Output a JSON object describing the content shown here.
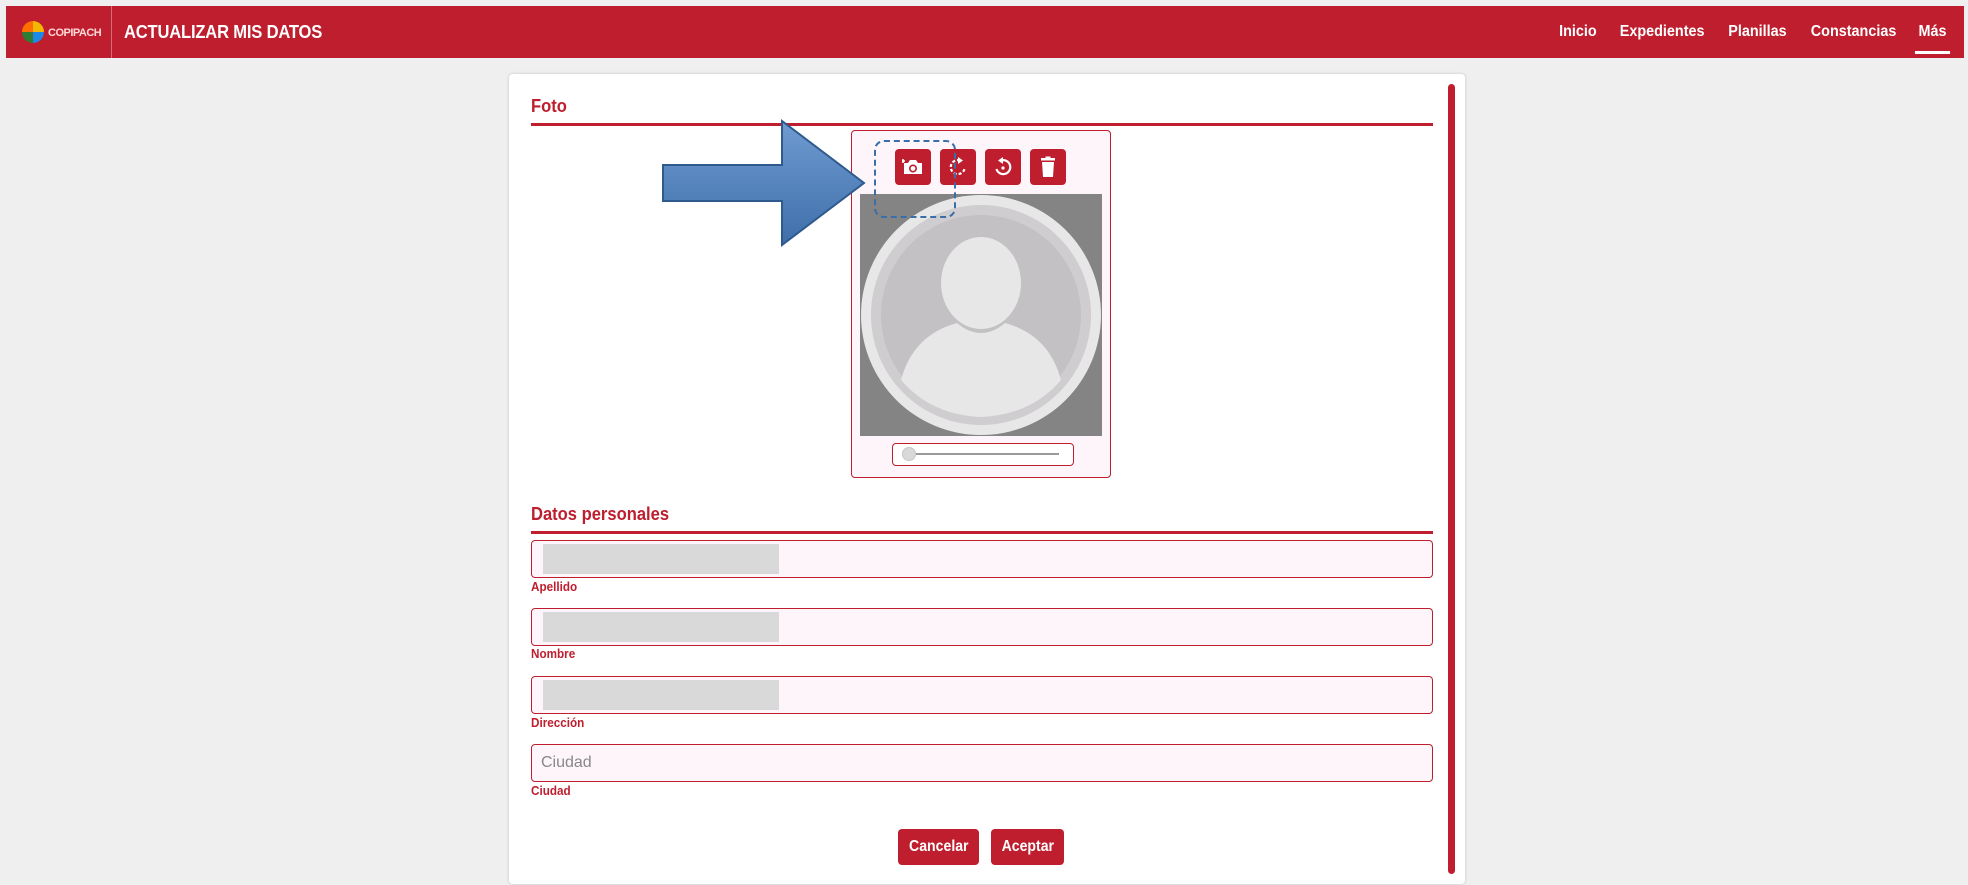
{
  "header": {
    "logo_text": "COPIPACH",
    "title": "ACTUALIZAR MIS DATOS",
    "nav": [
      {
        "label": "Inicio"
      },
      {
        "label": "Expedientes"
      },
      {
        "label": "Planillas"
      },
      {
        "label": "Constancias"
      },
      {
        "label": "Más",
        "active": true
      }
    ]
  },
  "photo_section": {
    "title": "Foto",
    "tools": [
      "camera-icon",
      "rotate-right-icon",
      "rotate-left-icon",
      "trash-icon"
    ],
    "zoom_level": 0
  },
  "personal_section": {
    "title": "Datos personales",
    "fields": [
      {
        "label": "Apellido",
        "value": "",
        "placeholder": ""
      },
      {
        "label": "Nombre",
        "value": "",
        "placeholder": ""
      },
      {
        "label": "Dirección",
        "value": "",
        "placeholder": ""
      },
      {
        "label": "Ciudad",
        "value": "",
        "placeholder": "Ciudad"
      }
    ]
  },
  "actions": {
    "cancel_label": "Cancelar",
    "accept_label": "Aceptar"
  },
  "colors": {
    "brand": "#be1e2d",
    "field_bg": "#fdf5fa",
    "annotation_arrow": "#4a7ebb"
  }
}
